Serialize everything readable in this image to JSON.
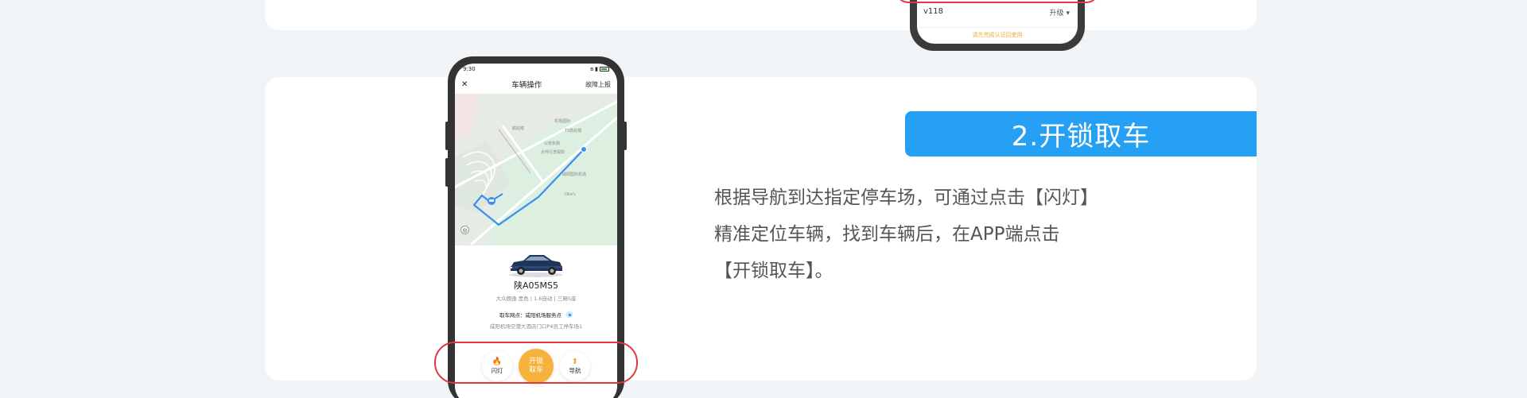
{
  "top_phone": {
    "version": "v118",
    "upgrade_label": "升级",
    "hint": "请先完成认证后使用"
  },
  "step": {
    "title": "2.开锁取车",
    "description": "根据导航到达指定停车场，可通过点击【闪灯】精准定位车辆，找到车辆后，在APP端点击【开锁取车】。"
  },
  "phone": {
    "status": {
      "time": "9:30"
    },
    "nav": {
      "close_glyph": "✕",
      "title": "车辆操作",
      "report": "故障上报"
    },
    "map_labels": [
      "航站楼",
      "机场国际",
      "T3航站楼",
      "公安执勤",
      "大件行李提取",
      "咸阳国际机场",
      "Oka's"
    ],
    "car": {
      "plate": "陕A05MS5",
      "model": "大众朗逸 黑色 | 1.6自动 | 三厢5座",
      "point_label": "取车网点：咸阳机场服务点",
      "address": "咸阳机场空港大酒店门口P4员工停车场1"
    },
    "actions": {
      "flash": "闪灯",
      "unlock_line1": "开锁",
      "unlock_line2": "取车",
      "navigate": "导航"
    }
  },
  "colors": {
    "accent_blue": "#26a0f4",
    "accent_orange": "#f7b23b",
    "highlight_red": "#e0383e",
    "background": "#f0f4f7"
  }
}
